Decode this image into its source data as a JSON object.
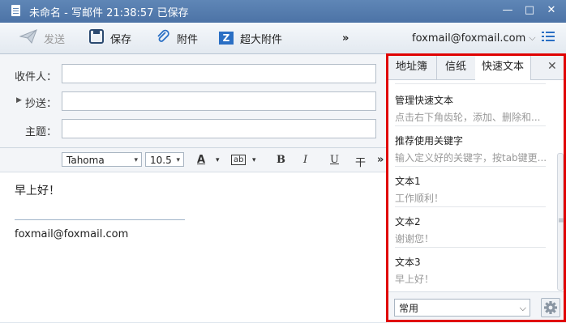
{
  "window": {
    "title": "未命名 - 写邮件   21:38:57 已保存",
    "minimize": "—",
    "maximize": "□",
    "close": "✕"
  },
  "toolbar": {
    "send_label": "发送",
    "save_label": "保存",
    "attach_label": "附件",
    "big_attach_label": "超大附件",
    "more": "»",
    "account": "foxmail@foxmail.com",
    "account_arrow": "⌵",
    "menu_icon": "menu-icon"
  },
  "compose": {
    "to_label": "收件人：",
    "cc_label": "抄送：",
    "cc_toggle": "▶",
    "subject_label": "主题：",
    "to_value": "",
    "cc_value": "",
    "subject_value": ""
  },
  "format": {
    "font": "Tahoma",
    "size": "10.5",
    "font_color": "A",
    "highlight": "ab",
    "bold": "B",
    "italic": "I",
    "underline": "U",
    "strike": "干",
    "more": "»",
    "arrow": "▾"
  },
  "body": {
    "greeting": "早上好！",
    "signature": "foxmail@foxmail.com"
  },
  "panel": {
    "tabs": [
      "地址簿",
      "信纸",
      "快速文本"
    ],
    "active_tab": "快速文本",
    "close": "✕",
    "items": [
      {
        "title": "管理快速文本",
        "sub": "点击右下角齿轮，添加、删除和..."
      },
      {
        "title": "推荐使用关键字",
        "sub": "输入定义好的关键字，按tab键更..."
      },
      {
        "title": "文本1",
        "sub": "工作顺利！"
      },
      {
        "title": "文本2",
        "sub": "谢谢您！"
      },
      {
        "title": "文本3",
        "sub": "早上好！"
      }
    ],
    "scroll_grip": "≡",
    "category": "常用",
    "category_arrow": "⌵"
  },
  "colors": {
    "titlebar": "#5f86b6",
    "highlight_frame": "#e00000",
    "icon_blue": "#2a6fc4"
  }
}
